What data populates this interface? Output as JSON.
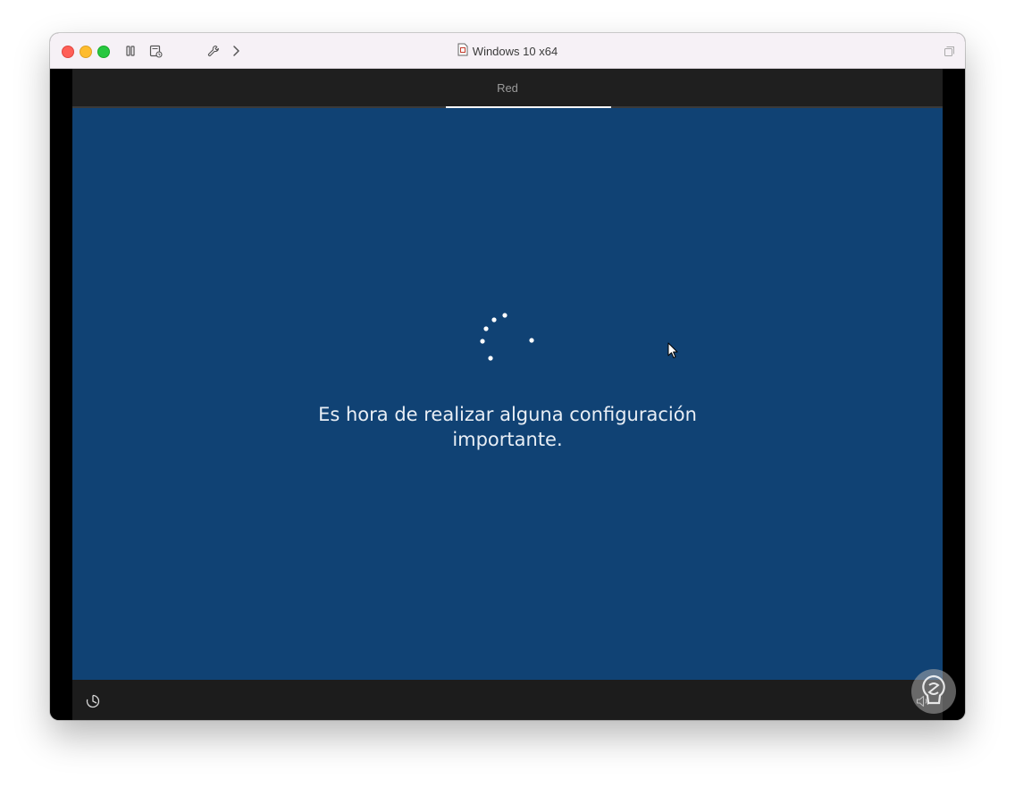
{
  "window": {
    "title": "Windows 10 x64"
  },
  "toolbar": {
    "icons": [
      "pause-icon",
      "snapshot-icon",
      "settings-wrench-icon",
      "forward-chevron-icon",
      "fullscreen-icon"
    ]
  },
  "setup": {
    "tab_label": "Red",
    "message_line1": "Es hora de realizar alguna configuración",
    "message_line2": "importante."
  },
  "bottom_bar": {
    "icons": [
      "ease-of-access-icon",
      "volume-icon"
    ]
  },
  "colors": {
    "setup_background": "#104274",
    "top_bar": "#1f1f1f",
    "bottom_bar": "#1c1c1c",
    "titlebar": "#f6f1f6",
    "accent_underline": "#ffffff"
  }
}
